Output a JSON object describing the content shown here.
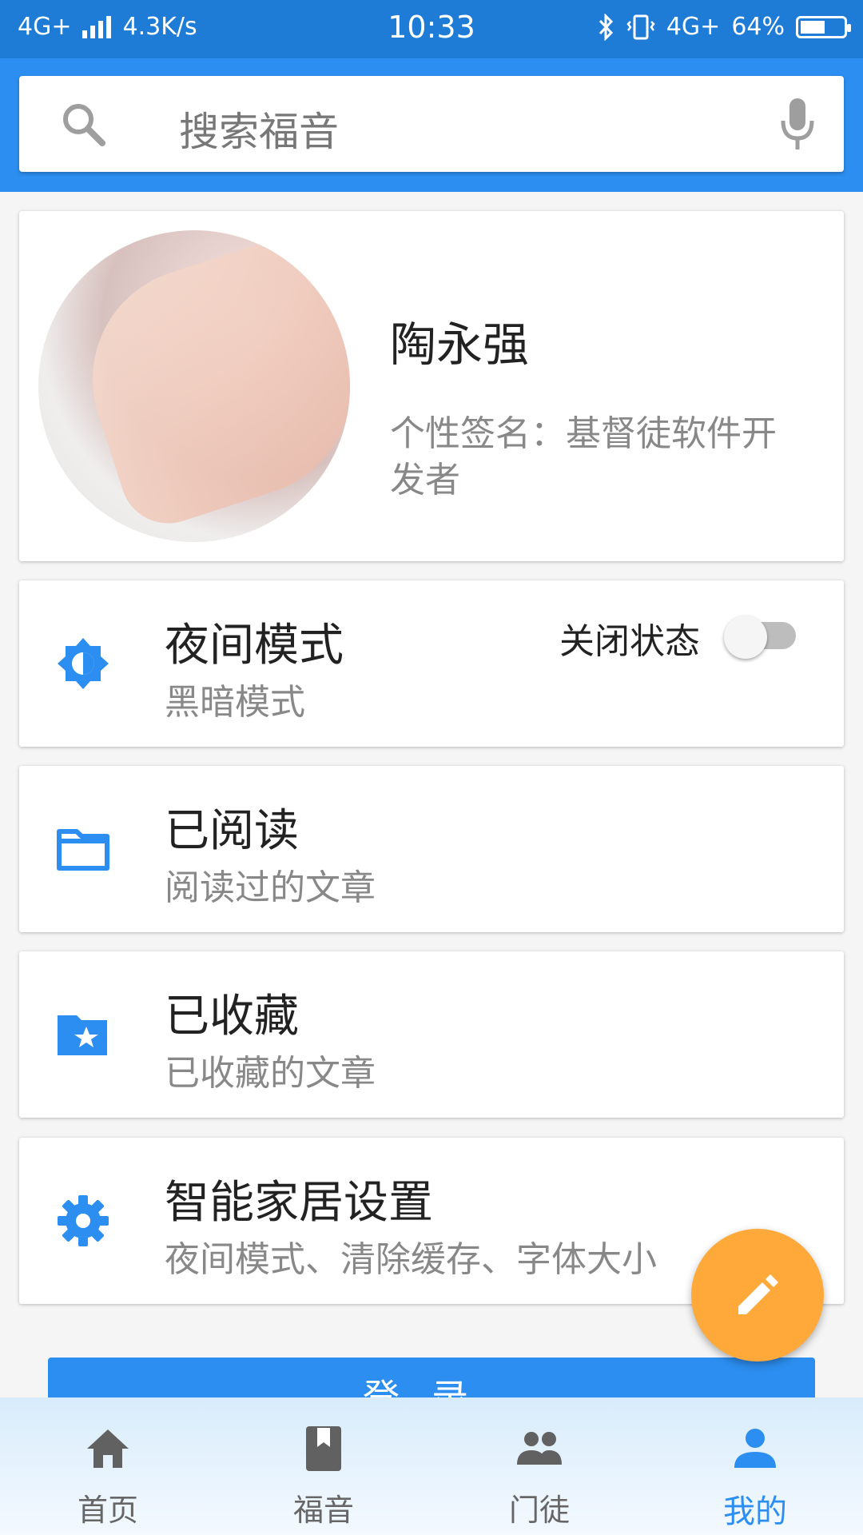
{
  "status_bar": {
    "network": "4G+",
    "speed": "4.3K/s",
    "time": "10:33",
    "network2": "4G+",
    "battery": "64%"
  },
  "search": {
    "placeholder": "搜索福音"
  },
  "profile": {
    "name": "陶永强",
    "signature": "个性签名：基督徒软件开发者"
  },
  "menu": [
    {
      "title": "夜间模式",
      "subtitle": "黑暗模式",
      "icon": "brightness-icon",
      "toggle_label": "关闭状态",
      "toggle_on": false
    },
    {
      "title": "已阅读",
      "subtitle": "阅读过的文章",
      "icon": "folder-icon"
    },
    {
      "title": "已收藏",
      "subtitle": "已收藏的文章",
      "icon": "star-folder-icon"
    },
    {
      "title": "智能家居设置",
      "subtitle": "夜间模式、清除缓存、字体大小",
      "icon": "gear-icon"
    }
  ],
  "login_button": "登录",
  "fab_icon": "edit-icon",
  "bottom_nav": [
    {
      "label": "首页",
      "icon": "home-icon"
    },
    {
      "label": "福音",
      "icon": "book-icon"
    },
    {
      "label": "门徒",
      "icon": "people-icon"
    },
    {
      "label": "我的",
      "icon": "person-icon",
      "active": true
    }
  ],
  "colors": {
    "primary": "#2c8ef0",
    "status_bar": "#1e7bd6",
    "fab": "#ffa93a"
  }
}
